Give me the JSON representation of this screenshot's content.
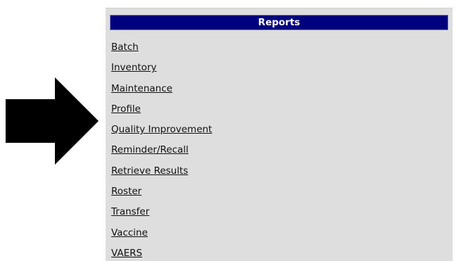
{
  "panel": {
    "title": "Reports",
    "items": [
      {
        "label": "Batch"
      },
      {
        "label": "Inventory"
      },
      {
        "label": "Maintenance"
      },
      {
        "label": "Profile"
      },
      {
        "label": "Quality Improvement"
      },
      {
        "label": "Reminder/Recall"
      },
      {
        "label": "Retrieve Results"
      },
      {
        "label": "Roster"
      },
      {
        "label": "Transfer"
      },
      {
        "label": "Vaccine"
      },
      {
        "label": "VAERS"
      }
    ]
  },
  "colors": {
    "header_bg": "#00007f",
    "panel_bg": "#dedede",
    "arrow": "#000000"
  },
  "icons": {
    "pointer": "right-arrow-icon"
  }
}
